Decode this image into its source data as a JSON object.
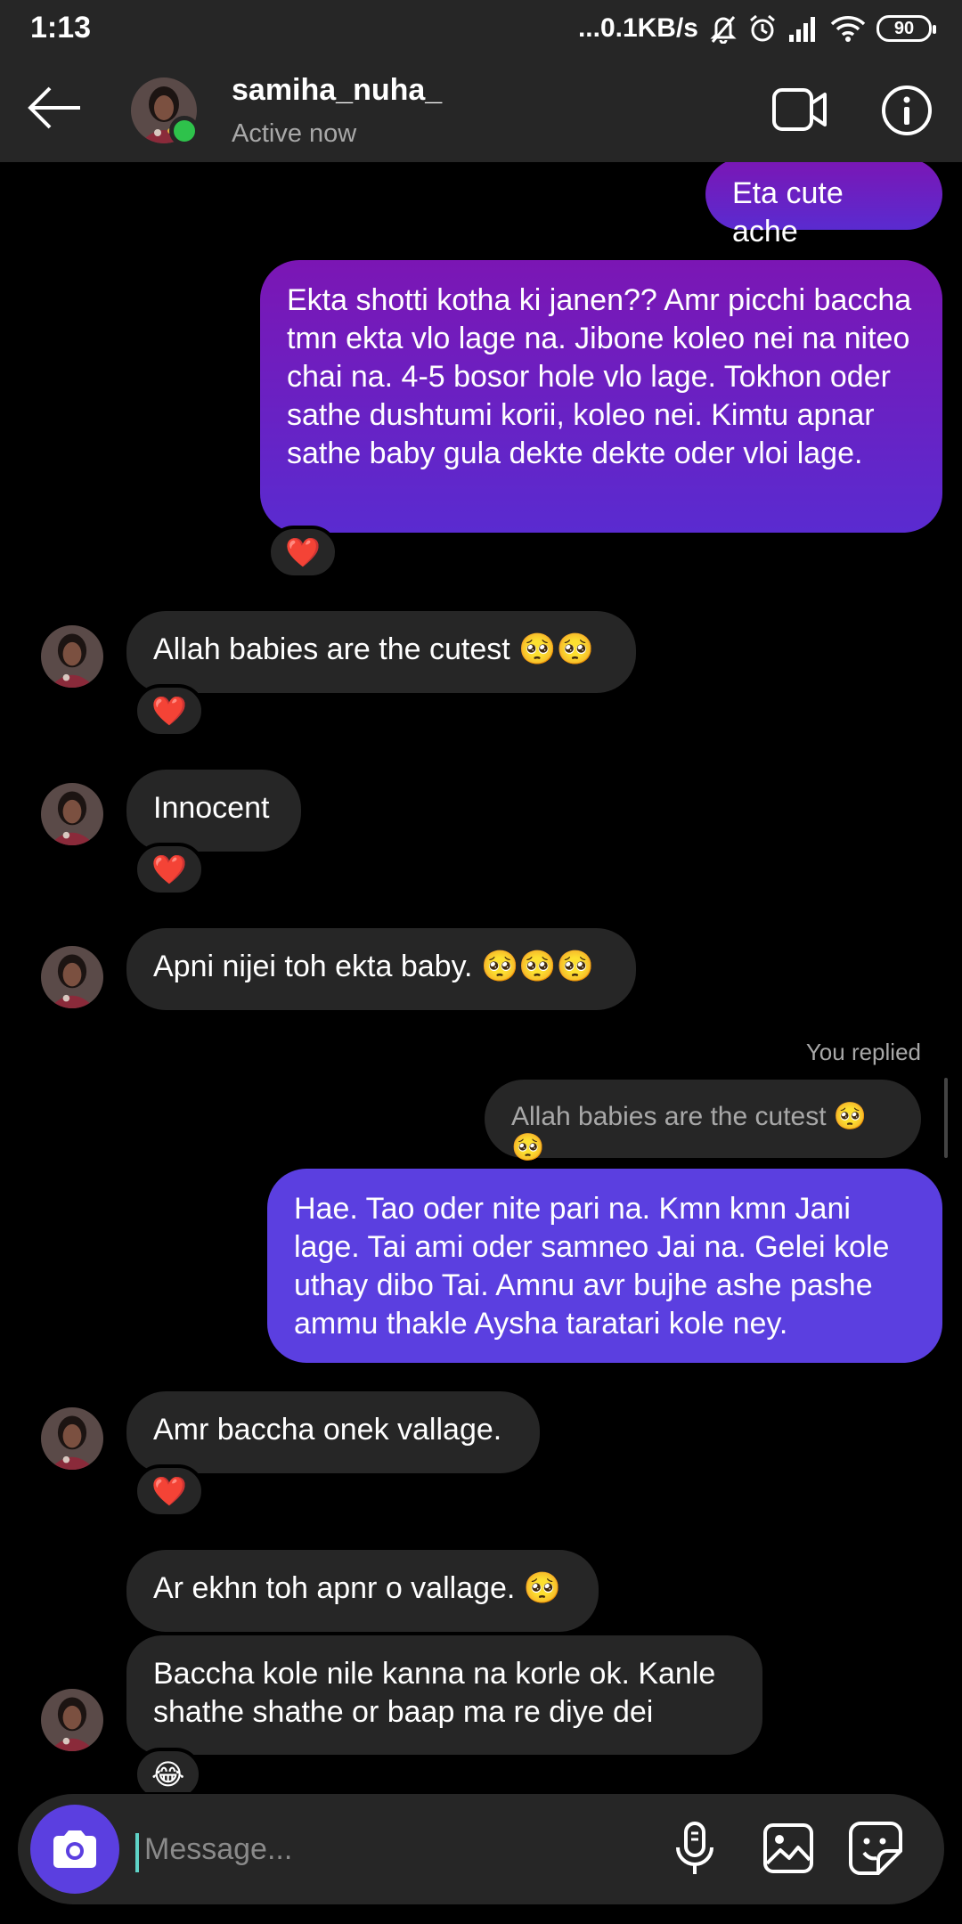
{
  "status_bar": {
    "time": "1:13",
    "network_speed": "...0.1KB/s",
    "battery": "90",
    "icons": [
      "mute-bell-icon",
      "alarm-icon",
      "signal-icon",
      "wifi-icon",
      "battery-icon"
    ]
  },
  "header": {
    "name": "samiha_nuha_",
    "status": "Active now",
    "online_color": "#2ec24b",
    "icons": [
      "back-arrow-icon",
      "video-call-icon",
      "info-icon"
    ]
  },
  "messages": [
    {
      "side": "out",
      "text": "Eta cute ache"
    },
    {
      "side": "out",
      "text": "Ekta shotti kotha ki janen?? Amr picchi baccha tmn ekta vlo lage na. Jibone koleo nei na niteo chai na. 4-5 bosor hole vlo lage. Tokhon oder sathe dushtumi korii, koleo nei. Kimtu apnar sathe baby gula dekte dekte oder vloi lage.",
      "reaction": "❤️"
    },
    {
      "side": "in",
      "text": "Allah babies are the cutest 🥺🥺",
      "reaction": "❤️"
    },
    {
      "side": "in",
      "text": "Innocent",
      "reaction": "❤️"
    },
    {
      "side": "in",
      "text": "Apni nijei toh ekta baby. 🥺🥺🥺"
    },
    {
      "side": "out",
      "replied_label": "You replied",
      "quoted": "Allah babies are the cutest 🥺🥺",
      "text": "Hae. Tao oder nite pari na. Kmn kmn Jani lage. Tai ami oder samneo Jai na. Gelei kole uthay dibo Tai. Amnu avr bujhe ashe pashe ammu thakle Aysha taratari kole ney."
    },
    {
      "side": "in",
      "text": "Amr baccha onek vallage.",
      "reaction": "❤️"
    },
    {
      "side": "in",
      "text": "Ar ekhn toh apnr o vallage. 🥺"
    },
    {
      "side": "in",
      "text": "Baccha kole nile kanna na korle ok. Kanle shathe shathe or baap ma re diye dei",
      "reaction": "😂"
    }
  ],
  "composer": {
    "placeholder": "Message...",
    "accent": "#5b3fe0",
    "icons": [
      "camera-icon",
      "microphone-icon",
      "gallery-icon",
      "sticker-icon"
    ]
  }
}
